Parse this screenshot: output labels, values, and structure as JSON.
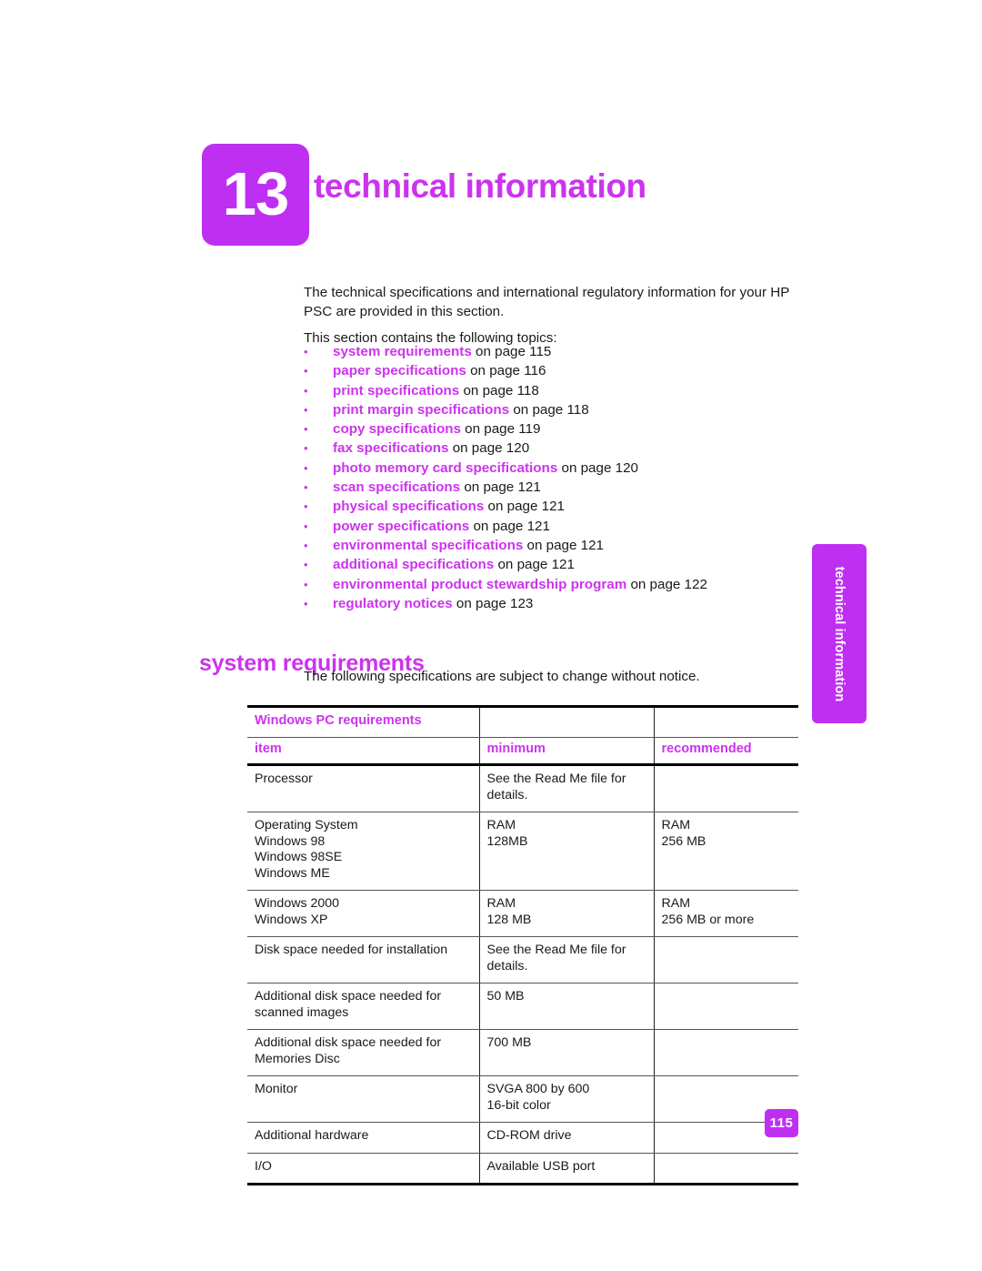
{
  "chapter": {
    "number": "13",
    "title": "technical information"
  },
  "intro": {
    "paragraph1": "The technical specifications and international regulatory information for your HP PSC are provided in this section.",
    "paragraph2": "This section contains the following topics:"
  },
  "topics": {
    "bullet_glyph": "•",
    "items": [
      {
        "link": "system requirements",
        "tail": " on page 115"
      },
      {
        "link": "paper specifications",
        "tail": " on page 116"
      },
      {
        "link": "print specifications",
        "tail": " on page 118"
      },
      {
        "link": "print margin specifications",
        "tail": " on page 118"
      },
      {
        "link": "copy specifications",
        "tail": " on page 119"
      },
      {
        "link": "fax specifications",
        "tail": " on page 120"
      },
      {
        "link": "photo memory card specifications",
        "tail": " on page 120"
      },
      {
        "link": "scan specifications",
        "tail": " on page 121"
      },
      {
        "link": "physical specifications",
        "tail": " on page 121"
      },
      {
        "link": "power specifications",
        "tail": " on page 121"
      },
      {
        "link": "environmental specifications",
        "tail": " on page 121"
      },
      {
        "link": "additional specifications",
        "tail": " on page 121"
      },
      {
        "link": "environmental product stewardship program",
        "tail": " on page 122"
      },
      {
        "link": "regulatory notices",
        "tail": " on page 123"
      }
    ]
  },
  "section": {
    "heading": "system requirements",
    "note": "The following specifications are subject to change without notice."
  },
  "side_tab": {
    "label": "technical information"
  },
  "table": {
    "caption": "Windows PC requirements",
    "columns": [
      "item",
      "minimum",
      "recommended"
    ],
    "rows": [
      {
        "item": [
          "Processor"
        ],
        "minimum": [
          "See the Read Me file for",
          "details."
        ],
        "recommended": []
      },
      {
        "item": [
          "Operating System",
          "Windows 98",
          "Windows 98SE",
          "Windows ME"
        ],
        "minimum": [
          "RAM",
          "128MB"
        ],
        "recommended": [
          "RAM",
          "256 MB"
        ]
      },
      {
        "item": [
          "Windows 2000",
          "Windows XP"
        ],
        "minimum": [
          "RAM",
          "128 MB"
        ],
        "recommended": [
          "RAM",
          "256 MB or more"
        ]
      },
      {
        "item": [
          "Disk space needed for installation"
        ],
        "minimum": [
          "See the Read Me file for",
          "details."
        ],
        "recommended": []
      },
      {
        "item": [
          "Additional disk space needed for",
          "scanned images"
        ],
        "minimum": [
          "50 MB"
        ],
        "recommended": []
      },
      {
        "item": [
          "Additional disk space needed for",
          "Memories Disc"
        ],
        "minimum": [
          "700 MB"
        ],
        "recommended": []
      },
      {
        "item": [
          "Monitor"
        ],
        "minimum": [
          "SVGA 800 by 600",
          "16-bit color"
        ],
        "recommended": []
      },
      {
        "item": [
          "Additional hardware"
        ],
        "minimum": [
          "CD-ROM drive"
        ],
        "recommended": []
      },
      {
        "item": [
          "I/O"
        ],
        "minimum": [
          "Available USB port"
        ],
        "recommended": []
      }
    ]
  },
  "footer": {
    "page_number": "115"
  },
  "colors": {
    "accent_magenta": "#cc33ee",
    "badge_magenta": "#bf2ff2",
    "text": "#1a1a1a"
  }
}
